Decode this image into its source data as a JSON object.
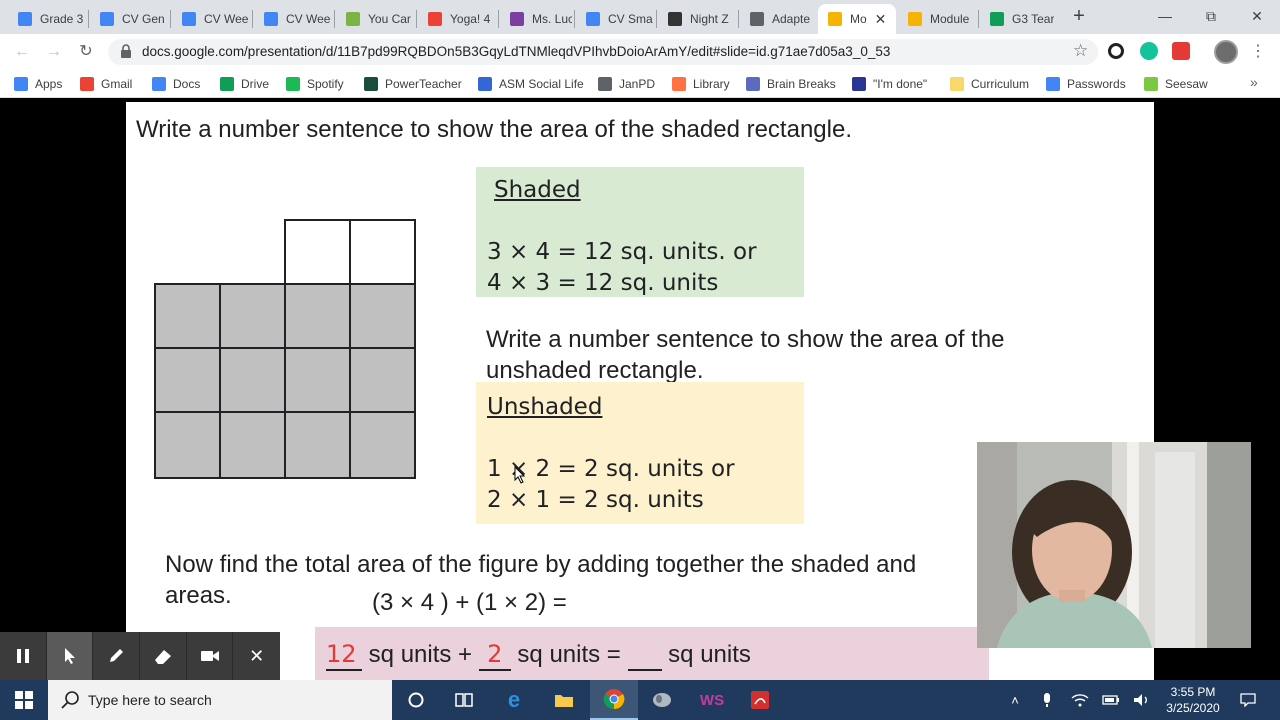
{
  "browser": {
    "tabs": [
      {
        "label": "Grade 3",
        "icon": "docs-icon",
        "color": "#4285f4"
      },
      {
        "label": "CV Gen",
        "icon": "docs-icon",
        "color": "#4285f4"
      },
      {
        "label": "CV Wee",
        "icon": "docs-icon",
        "color": "#4285f4"
      },
      {
        "label": "CV Wee",
        "icon": "docs-icon",
        "color": "#4285f4"
      },
      {
        "label": "You Car",
        "icon": "site-icon",
        "color": "#7cb342"
      },
      {
        "label": "Yoga! 4",
        "icon": "gmail-icon",
        "color": "#ea4335"
      },
      {
        "label": "Ms. Luc",
        "icon": "site-icon",
        "color": "#7b3fa0"
      },
      {
        "label": "CV Sma",
        "icon": "docs-icon",
        "color": "#4285f4"
      },
      {
        "label": "Night Z",
        "icon": "elephant-icon",
        "color": "#333333"
      },
      {
        "label": "Adapte",
        "icon": "globe-icon",
        "color": "#5f6368"
      },
      {
        "label": "Mo",
        "icon": "slides-icon",
        "color": "#f4b400",
        "active": true
      },
      {
        "label": "Module",
        "icon": "slides-icon",
        "color": "#f4b400"
      },
      {
        "label": "G3 Tear",
        "icon": "drive-icon",
        "color": "#0f9d58"
      }
    ],
    "url": "docs.google.com/presentation/d/11B7pd99RQBDOn5B3GqyLdTNMleqdVPIhvbDoioArAmY/edit#slide=id.g71ae7d05a3_0_53",
    "bookmarks": [
      {
        "label": "Apps",
        "icon": "apps-grid-icon",
        "color": "#4285f4"
      },
      {
        "label": "Gmail",
        "icon": "gmail-icon",
        "color": "#ea4335"
      },
      {
        "label": "Docs",
        "icon": "docs-icon",
        "color": "#4285f4"
      },
      {
        "label": "Drive",
        "icon": "drive-icon",
        "color": "#0f9d58"
      },
      {
        "label": "Spotify",
        "icon": "spotify-icon",
        "color": "#1db954"
      },
      {
        "label": "PowerTeacher",
        "icon": "powerteacher-icon",
        "color": "#1a4d3a"
      },
      {
        "label": "ASM Social Life",
        "icon": "site-icon",
        "color": "#3367d6"
      },
      {
        "label": "JanPD",
        "icon": "globe-icon",
        "color": "#5f6368"
      },
      {
        "label": "Library",
        "icon": "library-icon",
        "color": "#ff7043"
      },
      {
        "label": "Brain Breaks",
        "icon": "site-icon",
        "color": "#5c6bc0"
      },
      {
        "label": "\"I'm done\"",
        "icon": "table-icon",
        "color": "#283593"
      },
      {
        "label": "Curriculum",
        "icon": "folder-icon",
        "color": "#f9d86b"
      },
      {
        "label": "Passwords",
        "icon": "docs-icon",
        "color": "#4285f4"
      },
      {
        "label": "Seesaw",
        "icon": "seesaw-icon",
        "color": "#7ac943"
      }
    ]
  },
  "slide": {
    "heading": "Write a number sentence to show the area of the shaded rectangle.",
    "shaded_title": "Shaded",
    "shaded_line1": "3 × 4 = 12 sq. units. or",
    "shaded_line2": "4 × 3 = 12 sq. units",
    "prompt2_line1": "Write a number sentence to show the area of the",
    "prompt2_line2": "unshaded rectangle.",
    "unshaded_title": "Unshaded",
    "unshaded_line1": "1 × 2 = 2 sq. units or",
    "unshaded_line2": "2 × 1 = 2 sq. units",
    "total_line1": "Now find the total area of the figure by adding together the shaded and",
    "total_line2": "areas.",
    "expression": "(3 × 4 ) + (1 × 2) =",
    "answer_shaded": "12",
    "answer_unshaded": "2",
    "answer_text1": "sq units +",
    "answer_text2": "sq units =",
    "answer_text3": "sq units",
    "colors": {
      "shaded_box": "#d9ead3",
      "unshaded_box": "#fdf2cd",
      "answer_box": "#ead1dc",
      "grid_fill": "#c0c0c0",
      "handwriting": "#e53935"
    }
  },
  "taskbar": {
    "search_placeholder": "Type here to search",
    "time": "3:55 PM",
    "date": "3/25/2020"
  }
}
